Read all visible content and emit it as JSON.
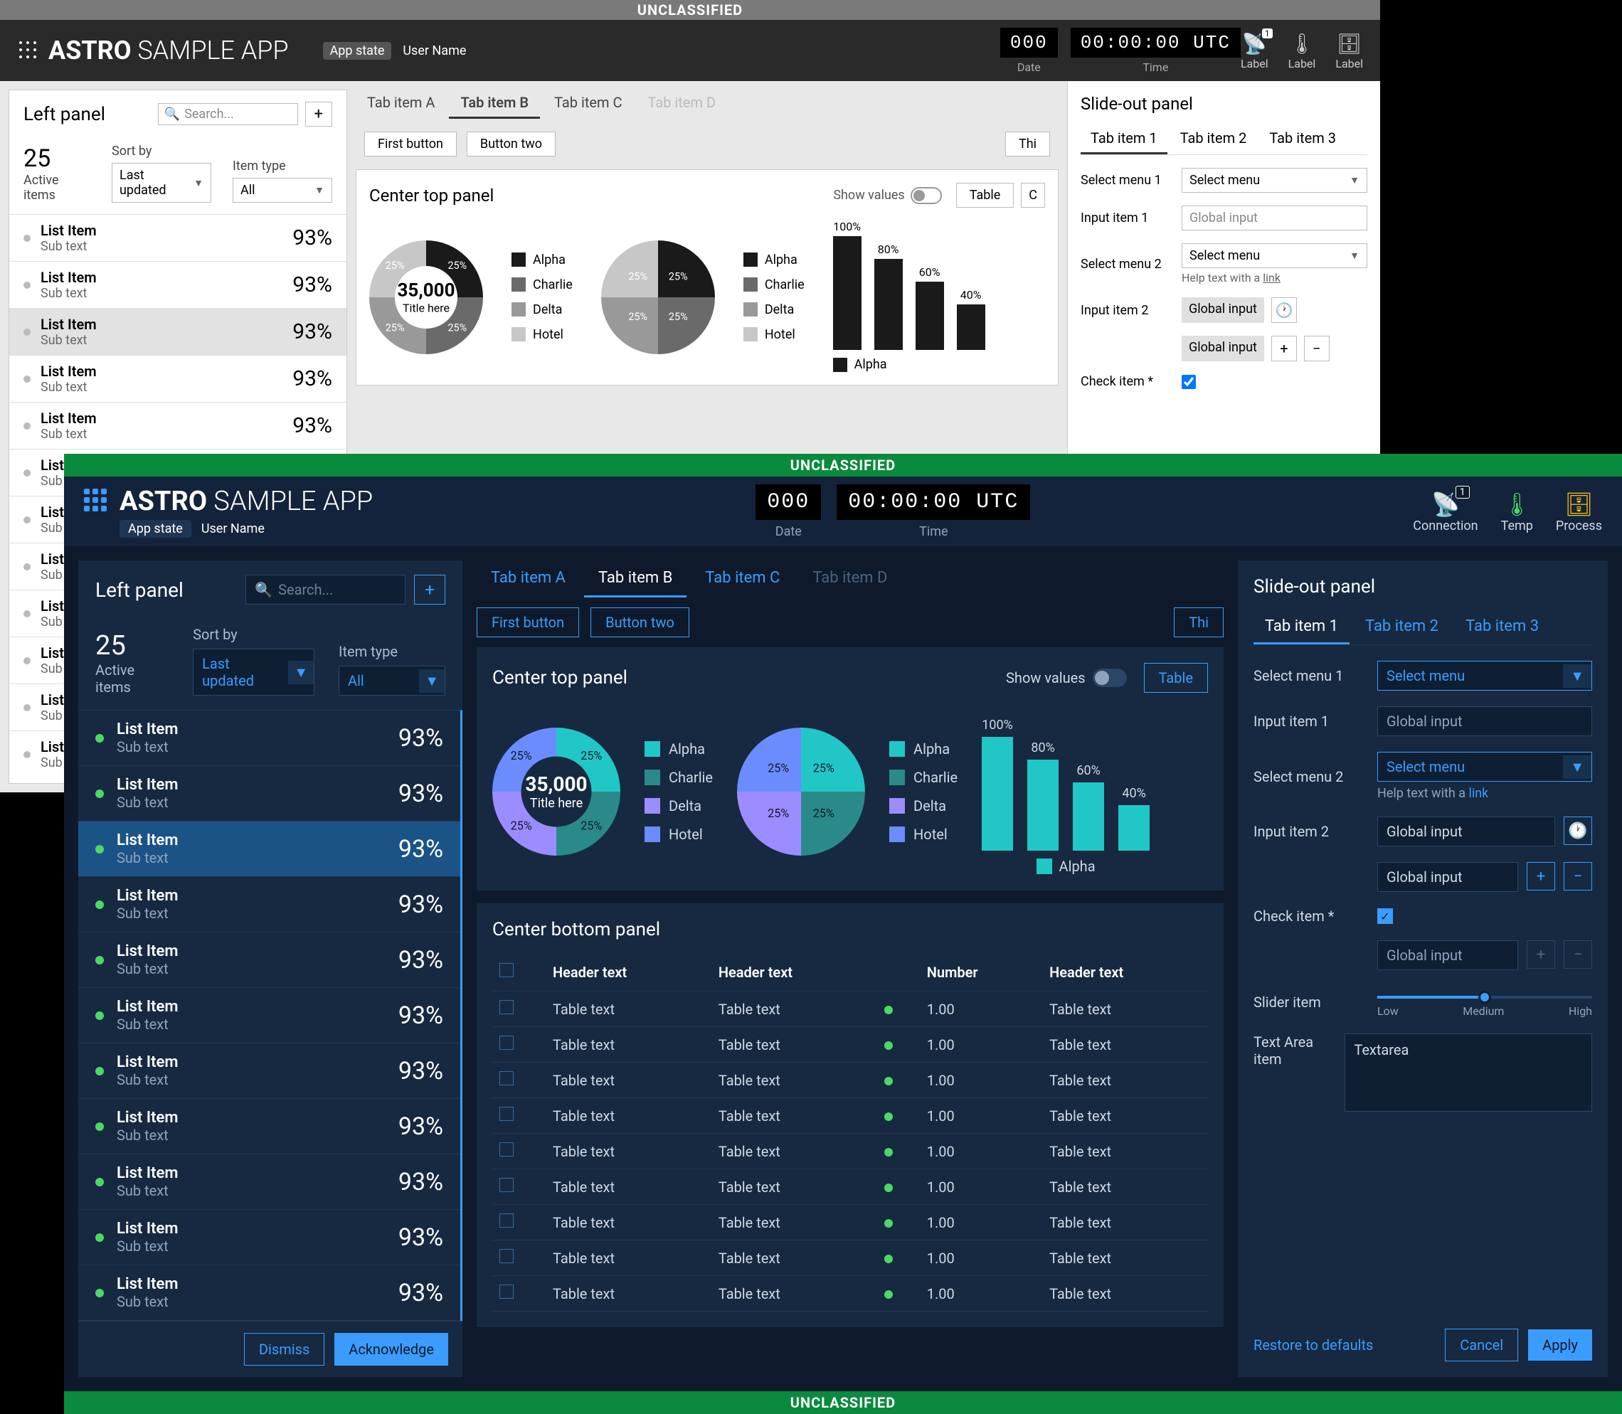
{
  "classification": "UNCLASSIFIED",
  "app": {
    "title_bold": "ASTRO",
    "title_rest": "SAMPLE APP",
    "state": "App state",
    "user": "User Name"
  },
  "clock": {
    "date_val": "000",
    "date_lbl": "Date",
    "time_val": "00:00:00 UTC",
    "time_lbl": "Time"
  },
  "status_light": [
    {
      "icon": "📡",
      "label": "Label",
      "badge": "1"
    },
    {
      "icon": "🌡",
      "label": "Label"
    },
    {
      "icon": "🗄",
      "label": "Label"
    }
  ],
  "status_dark": [
    {
      "icon": "📡",
      "label": "Connection",
      "badge": "1"
    },
    {
      "icon": "🌡",
      "label": "Temp"
    },
    {
      "icon": "🗄",
      "label": "Process"
    }
  ],
  "left_panel": {
    "title": "Left panel",
    "search_placeholder": "Search...",
    "count": "25",
    "count_lbl": "Active items",
    "sort_lbl": "Sort by",
    "sort_val": "Last updated",
    "type_lbl": "Item type",
    "type_val": "All",
    "item_title": "List Item",
    "item_sub": "Sub text",
    "item_pct": "93%",
    "dismiss": "Dismiss",
    "acknowledge": "Acknowledge"
  },
  "tabs": [
    "Tab item A",
    "Tab item B",
    "Tab item C",
    "Tab item D"
  ],
  "buttons": {
    "first": "First button",
    "two": "Button two",
    "third": "Thi"
  },
  "center_top": {
    "title": "Center top panel",
    "show_values": "Show values",
    "table_btn": "Table",
    "donut_center_big": "35,000",
    "donut_center_sm": "Title here"
  },
  "chart_data": {
    "donut1": {
      "type": "pie",
      "categories": [
        "Alpha",
        "Charlie",
        "Delta",
        "Hotel"
      ],
      "values": [
        25,
        25,
        25,
        25
      ],
      "title": "35,000 Title here",
      "inner_radius": 0.55
    },
    "donut2": {
      "type": "pie",
      "categories": [
        "Alpha",
        "Charlie",
        "Delta",
        "Hotel"
      ],
      "values": [
        25,
        25,
        25,
        25
      ]
    },
    "bars": {
      "type": "bar",
      "categories": [
        "",
        "",
        "",
        ""
      ],
      "values": [
        100,
        80,
        60,
        40
      ],
      "series_name": "Alpha",
      "ylim": [
        0,
        100
      ]
    }
  },
  "legend_items": [
    "Alpha",
    "Charlie",
    "Delta",
    "Hotel"
  ],
  "colors_light": [
    "#1a1a1a",
    "#6a6a6a",
    "#999",
    "#c7c7c7"
  ],
  "colors_dark": [
    "#21c7c7",
    "#2a8a8a",
    "#9b8cff",
    "#6b8cff"
  ],
  "center_bottom": {
    "title": "Center bottom panel",
    "headers": [
      "",
      "Header text",
      "Header text",
      "",
      "Number",
      "Header text"
    ],
    "cell_text": "Table text",
    "cell_num": "1.00",
    "rows": 9
  },
  "slideout": {
    "title": "Slide-out panel",
    "tabs": [
      "Tab item 1",
      "Tab item 2",
      "Tab item 3"
    ],
    "select_menu_1": "Select menu 1",
    "select_menu_2": "Select menu 2",
    "select_placeholder": "Select menu",
    "input_item_1": "Input item 1",
    "input_item_2": "Input item 2",
    "global_input": "Global input",
    "help": "Help text with a",
    "help_link": "link",
    "check_item": "Check item *",
    "slider_item": "Slider item",
    "slider_ticks": [
      "Low",
      "Medium",
      "High"
    ],
    "textarea_item": "Text Area item",
    "textarea_val": "Textarea",
    "restore": "Restore to defaults",
    "cancel": "Cancel",
    "apply": "Apply"
  }
}
